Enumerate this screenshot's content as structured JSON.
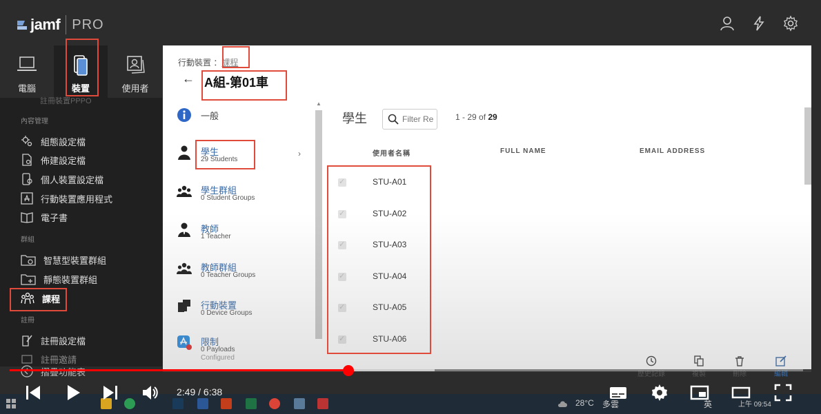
{
  "brand": {
    "name": "jamf",
    "product": "PRO"
  },
  "nav_tabs": [
    {
      "label": "電腦"
    },
    {
      "label": "裝置"
    },
    {
      "label": "使用者"
    }
  ],
  "sidebar": {
    "clipped_item": "註冊裝置PPPO",
    "section_content": "內容管理",
    "items_content": [
      "組態設定檔",
      "佈建設定檔",
      "個人裝置設定檔",
      "行動裝置應用程式",
      "電子書"
    ],
    "section_groups": "群組",
    "items_groups": [
      "智慧型裝置群組",
      "靜態裝置群組",
      "課程"
    ],
    "section_enroll": "註冊",
    "items_enroll": [
      "註冊設定檔",
      "註冊邀請"
    ],
    "collapse": "摺疊功能表"
  },
  "breadcrumb": {
    "prefix": "行動裝置 ：",
    "link": "課程"
  },
  "page_title": "A組-第01車",
  "class_sections": [
    {
      "title": "一般",
      "sub": ""
    },
    {
      "title": "學生",
      "sub": "29 Students"
    },
    {
      "title": "學生群組",
      "sub": "0 Student Groups"
    },
    {
      "title": "教師",
      "sub": "1 Teacher"
    },
    {
      "title": "教師群組",
      "sub": "0 Teacher Groups"
    },
    {
      "title": "行動裝置",
      "sub": "0 Device Groups"
    },
    {
      "title": "限制",
      "sub": "0 Payloads",
      "sub2": "Configured"
    }
  ],
  "students": {
    "heading": "學生",
    "search_placeholder": "Filter Re",
    "count_range": "1 - 29 of ",
    "count_total": "29",
    "columns": [
      "使用者名稱",
      "FULL NAME",
      "EMAIL ADDRESS"
    ],
    "rows": [
      "STU-A01",
      "STU-A02",
      "STU-A03",
      "STU-A04",
      "STU-A05",
      "STU-A06"
    ]
  },
  "actions": [
    "歷史記錄",
    "複製",
    "刪除",
    "編輯"
  ],
  "video": {
    "time": "2:49 / 6:38",
    "progress": 0.427
  },
  "taskbar": {
    "weather": "28°C",
    "weather_desc": "多雲",
    "ime": "英",
    "time": "上午 09:54"
  },
  "colors": {
    "accent": "#3a6aa6",
    "highlight": "#e04a3a",
    "progress": "#ff0000",
    "sidebar": "#202020"
  }
}
